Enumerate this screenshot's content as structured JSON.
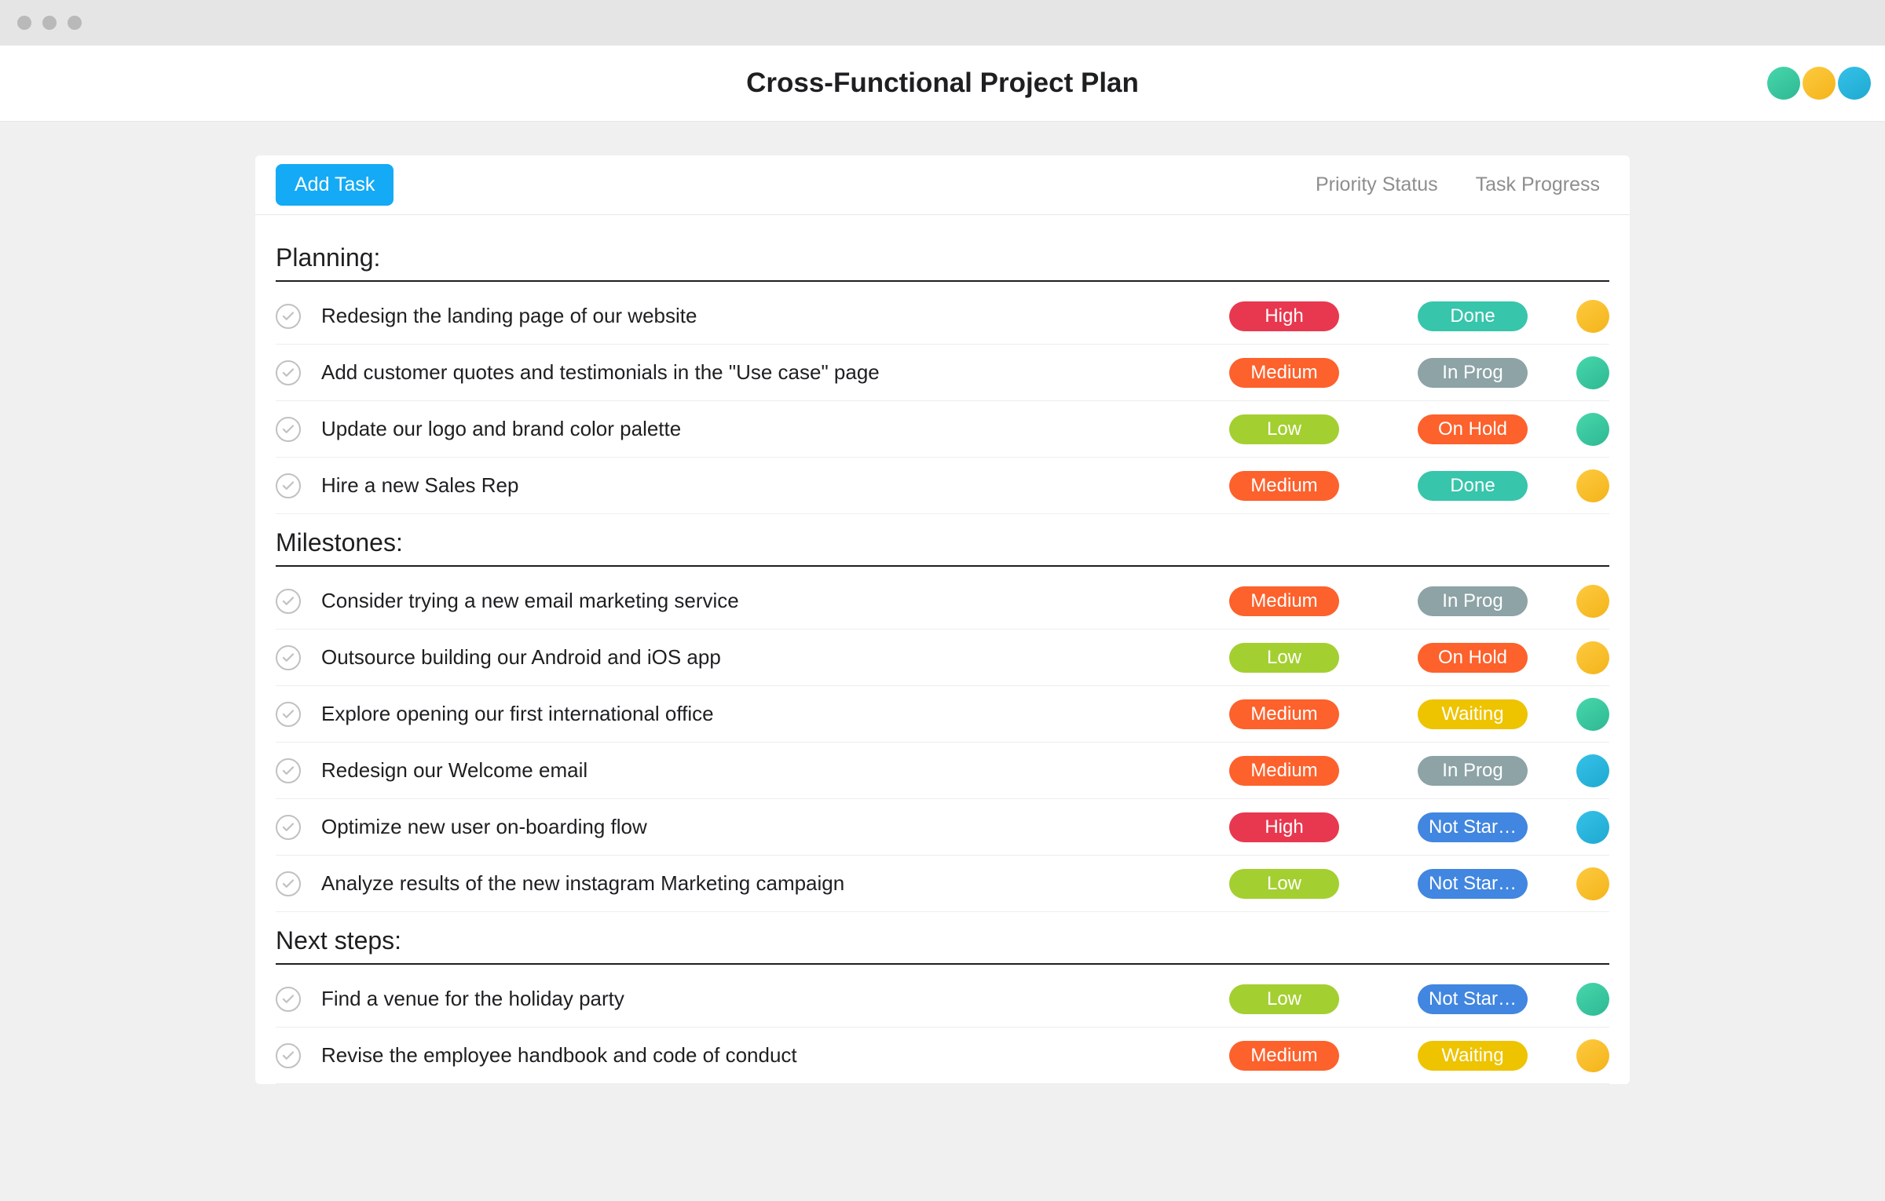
{
  "header": {
    "title": "Cross-Functional Project Plan"
  },
  "toolbar": {
    "add_task": "Add Task",
    "col_priority": "Priority Status",
    "col_progress": "Task Progress"
  },
  "avatars_top": [
    {
      "color": "green"
    },
    {
      "color": "yellow"
    },
    {
      "color": "blue"
    }
  ],
  "colors": {
    "priority": {
      "High": "pill-high",
      "Medium": "pill-medium",
      "Low": "pill-low"
    },
    "progress": {
      "Done": "pill-done",
      "In Prog": "pill-inprog",
      "On Hold": "pill-onhold",
      "Waiting": "pill-waiting",
      "Not Star…": "pill-notstar"
    }
  },
  "sections": [
    {
      "title": "Planning:",
      "tasks": [
        {
          "title": "Redesign the landing page of our website",
          "priority": "High",
          "progress": "Done",
          "assignee": "yellow"
        },
        {
          "title": "Add customer quotes and testimonials in the \"Use case\" page",
          "priority": "Medium",
          "progress": "In Prog",
          "assignee": "green"
        },
        {
          "title": "Update our logo and brand color palette",
          "priority": "Low",
          "progress": "On Hold",
          "assignee": "green"
        },
        {
          "title": "Hire a new Sales Rep",
          "priority": "Medium",
          "progress": "Done",
          "assignee": "yellow"
        }
      ]
    },
    {
      "title": "Milestones:",
      "tasks": [
        {
          "title": "Consider trying a new email marketing service",
          "priority": "Medium",
          "progress": "In Prog",
          "assignee": "yellow"
        },
        {
          "title": "Outsource building our Android and iOS app",
          "priority": "Low",
          "progress": "On Hold",
          "assignee": "yellow"
        },
        {
          "title": "Explore opening our first international office",
          "priority": "Medium",
          "progress": "Waiting",
          "assignee": "green"
        },
        {
          "title": "Redesign our Welcome email",
          "priority": "Medium",
          "progress": "In Prog",
          "assignee": "blue"
        },
        {
          "title": "Optimize new user on-boarding flow",
          "priority": "High",
          "progress": "Not Star…",
          "assignee": "blue"
        },
        {
          "title": "Analyze results of the new instagram Marketing campaign",
          "priority": "Low",
          "progress": "Not Star…",
          "assignee": "yellow"
        }
      ]
    },
    {
      "title": "Next steps:",
      "tasks": [
        {
          "title": "Find a venue for the holiday party",
          "priority": "Low",
          "progress": "Not Star…",
          "assignee": "green"
        },
        {
          "title": "Revise the employee handbook and code of conduct",
          "priority": "Medium",
          "progress": "Waiting",
          "assignee": "yellow"
        }
      ]
    }
  ]
}
